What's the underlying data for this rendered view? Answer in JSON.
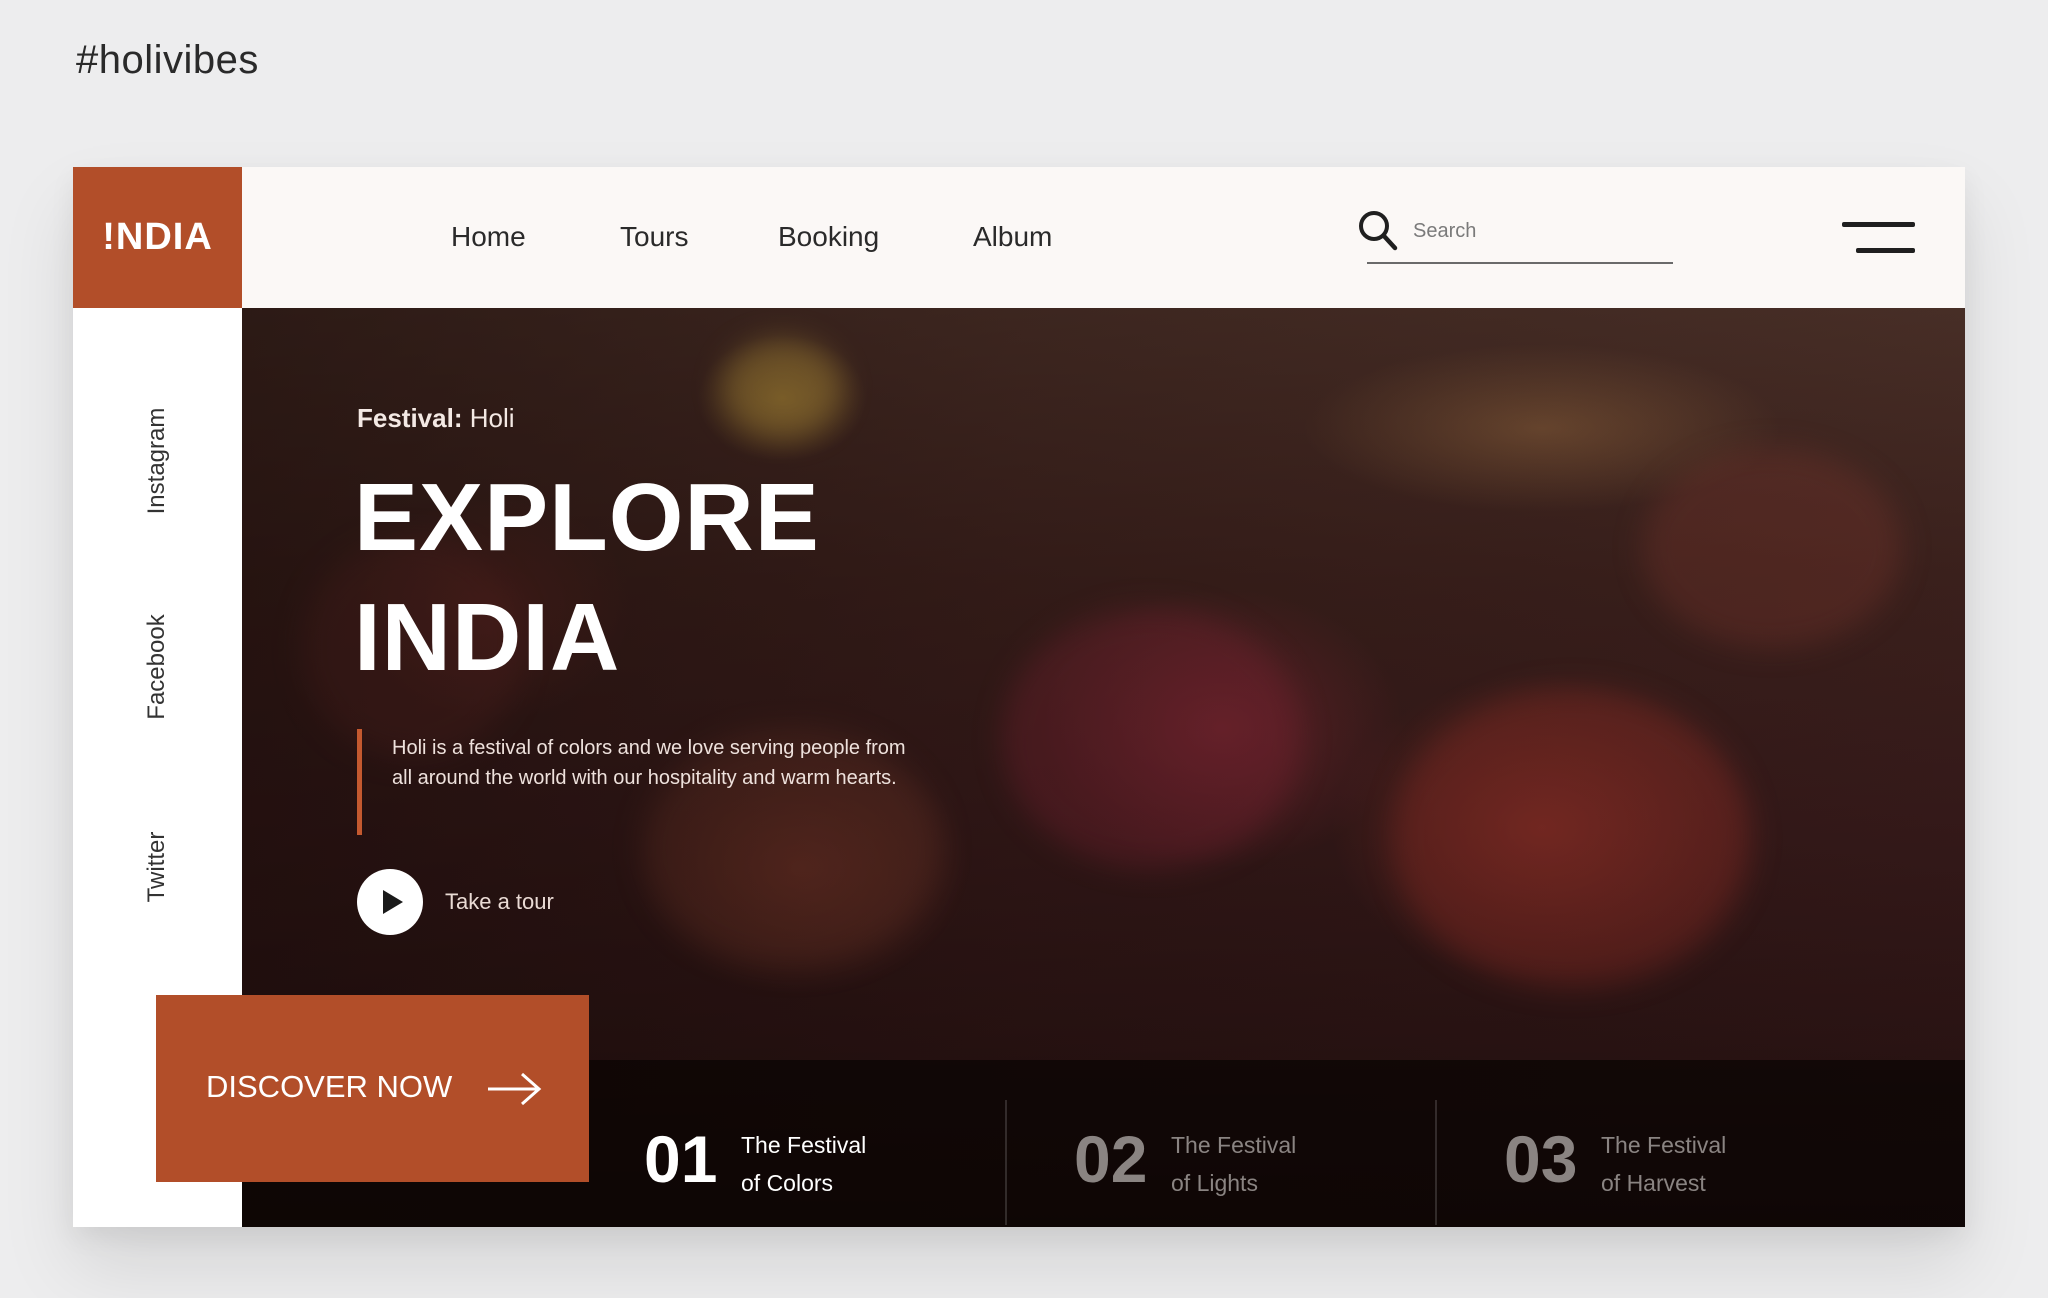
{
  "tagline": "#holivibes",
  "logo": {
    "text": "!NDIA"
  },
  "nav": {
    "items": [
      "Home",
      "Tours",
      "Booking",
      "Album"
    ]
  },
  "search": {
    "placeholder": "Search",
    "icon": "search-icon"
  },
  "menu": {
    "icon": "hamburger-menu-icon"
  },
  "social": {
    "items": [
      "Instagram",
      "Facebook",
      "Twitter"
    ]
  },
  "hero": {
    "festival_label": "Festival:",
    "festival_value": "Holi",
    "title_line1": "EXPLORE",
    "title_line2": "INDIA",
    "description": "Holi is a festival of colors and we love serving people from all around the world with our hospitality and warm hearts.",
    "play_label": "Take a tour"
  },
  "discover": {
    "label": "DISCOVER NOW",
    "icon": "arrow-right-icon"
  },
  "festivals": [
    {
      "number": "01",
      "line1": "The Festival",
      "line2": "of Colors",
      "active": true
    },
    {
      "number": "02",
      "line1": "The Festival",
      "line2": "of Lights",
      "active": false
    },
    {
      "number": "03",
      "line1": "The Festival",
      "line2": "of Harvest",
      "active": false
    }
  ],
  "colors": {
    "accent": "#b24e29",
    "page_background": "#ededee",
    "header_background": "#fbf8f6",
    "active_text": "#ffffff",
    "inactive_text": "#8a8482"
  }
}
